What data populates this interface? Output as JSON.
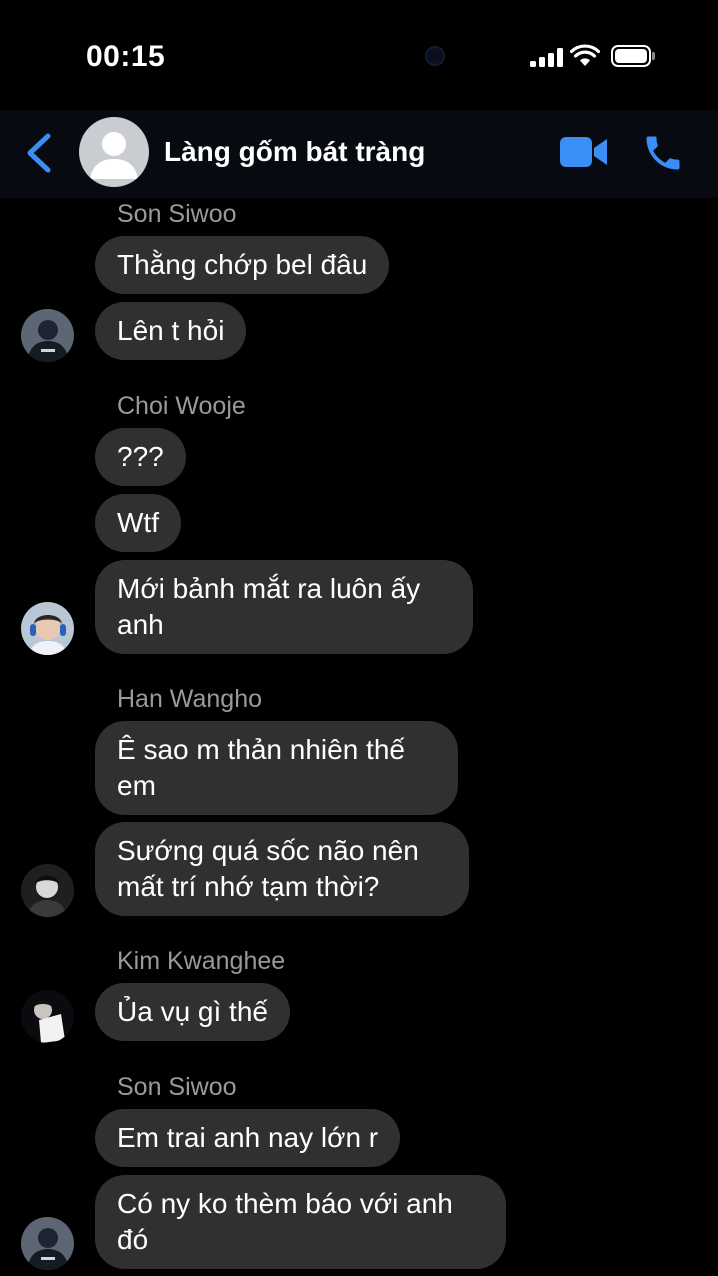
{
  "status_bar": {
    "time": "00:15"
  },
  "header": {
    "title": "Làng gốm bát tràng"
  },
  "messages": [
    {
      "sender": "Son Siwoo",
      "bubbles": [
        "Thằng chớp bel đâu",
        "Lên t hỏi"
      ]
    },
    {
      "sender": "Choi Wooje",
      "bubbles": [
        "???",
        "Wtf",
        "Mới bảnh mắt ra luôn ấy anh"
      ]
    },
    {
      "sender": "Han Wangho",
      "bubbles": [
        "Ê sao m thản nhiên thế em",
        "Sướng quá sốc não nên mất trí nhớ tạm thời?"
      ]
    },
    {
      "sender": "Kim Kwanghee",
      "bubbles": [
        "Ủa vụ gì thế"
      ]
    },
    {
      "sender": "Son Siwoo",
      "bubbles": [
        "Em trai anh nay lớn r",
        "Có ny ko thèm báo với anh đó"
      ]
    }
  ],
  "colors": {
    "accent": "#3a8ef6",
    "bubble": "#303030",
    "sender": "#9a9a9e"
  }
}
